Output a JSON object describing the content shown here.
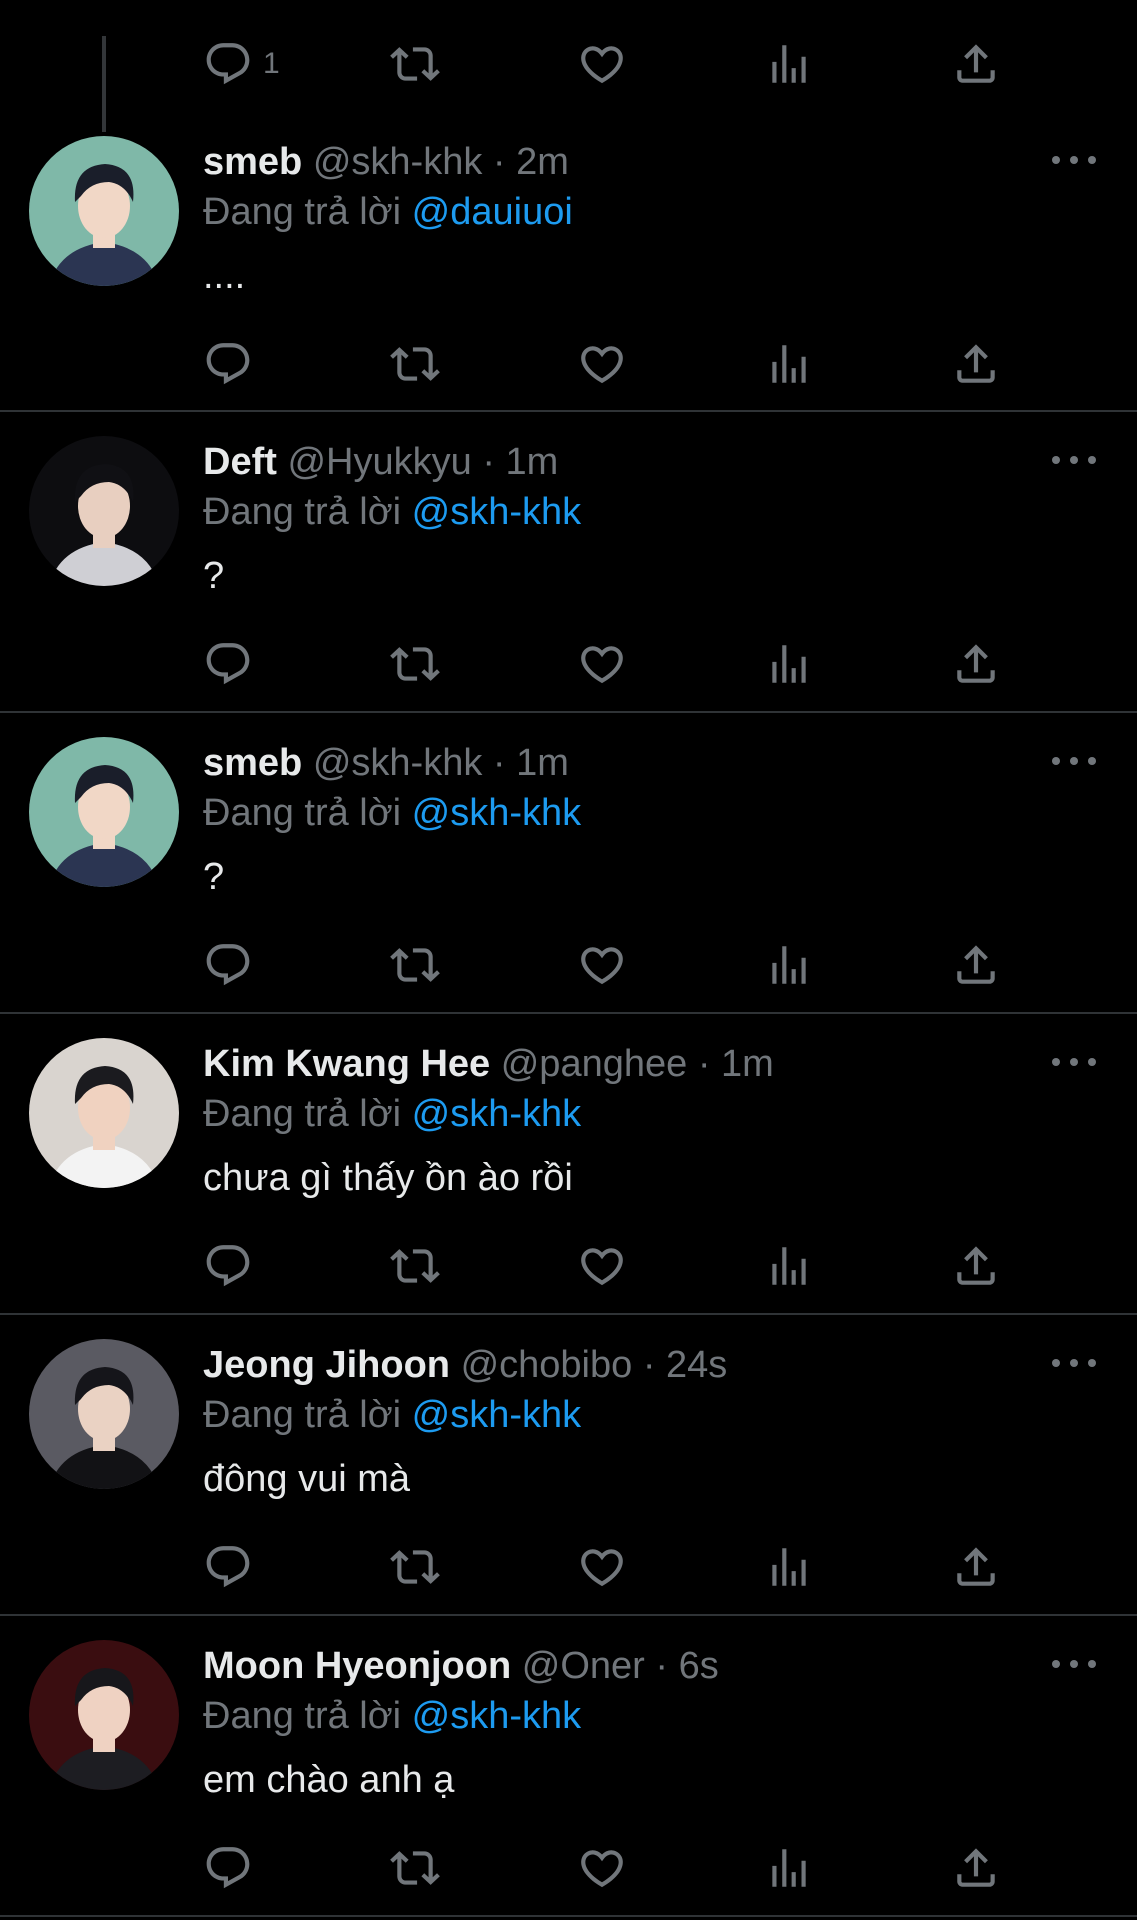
{
  "top_fragment": {
    "reply_count": "1"
  },
  "tweets": [
    {
      "name": "smeb",
      "handle": "@skh-khk",
      "dot": "·",
      "time": "2m",
      "reply_prefix": "Đang trả lời",
      "reply_to": "@dauiuoi",
      "text": "....",
      "avatar_colors": {
        "bg": "#7fb8a8",
        "hair": "#1a1e2a",
        "skin": "#f1d7c6",
        "shirt": "#2b3552"
      }
    },
    {
      "name": "Deft",
      "handle": "@Hyukkyu",
      "dot": "·",
      "time": "1m",
      "reply_prefix": "Đang trả lời",
      "reply_to": "@skh-khk",
      "text": "?",
      "avatar_colors": {
        "bg": "#0d0d10",
        "hair": "#101014",
        "skin": "#e8cfc0",
        "shirt": "#cfcfd4"
      }
    },
    {
      "name": "smeb",
      "handle": "@skh-khk",
      "dot": "·",
      "time": "1m",
      "reply_prefix": "Đang trả lời",
      "reply_to": "@skh-khk",
      "text": "?",
      "avatar_colors": {
        "bg": "#7fb8a8",
        "hair": "#1a1e2a",
        "skin": "#f1d7c6",
        "shirt": "#2b3552"
      }
    },
    {
      "name": "Kim Kwang Hee",
      "handle": "@panghee",
      "dot": "·",
      "time": "1m",
      "reply_prefix": "Đang trả lời",
      "reply_to": "@skh-khk",
      "text": "chưa gì thấy ồn ào rồi",
      "avatar_colors": {
        "bg": "#d9d4cf",
        "hair": "#1b1b1f",
        "skin": "#f0d2c0",
        "shirt": "#f3f3f3"
      }
    },
    {
      "name": "Jeong Jihoon",
      "handle": "@chobibo",
      "dot": "·",
      "time": "24s",
      "reply_prefix": "Đang trả lời",
      "reply_to": "@skh-khk",
      "text": "đông vui mà",
      "avatar_colors": {
        "bg": "#5a5a62",
        "hair": "#15151a",
        "skin": "#ead2c3",
        "shirt": "#121215"
      }
    },
    {
      "name": "Moon Hyeonjoon",
      "handle": "@Oner",
      "dot": "·",
      "time": "6s",
      "reply_prefix": "Đang trả lời",
      "reply_to": "@skh-khk",
      "text": "em chào anh ạ",
      "avatar_colors": {
        "bg": "#3a0d10",
        "hair": "#17171b",
        "skin": "#efd2c2",
        "shirt": "#1d1d22"
      }
    }
  ],
  "icons": {
    "reply": "reply-icon",
    "retweet": "retweet-icon",
    "like": "heart-icon",
    "views": "views-icon",
    "share": "share-icon",
    "more": "more-icon"
  },
  "colors": {
    "background": "#000000",
    "primary_text": "#e7e9ea",
    "secondary_text": "#71767b",
    "accent": "#1d9bf0",
    "divider": "#2f3336"
  }
}
